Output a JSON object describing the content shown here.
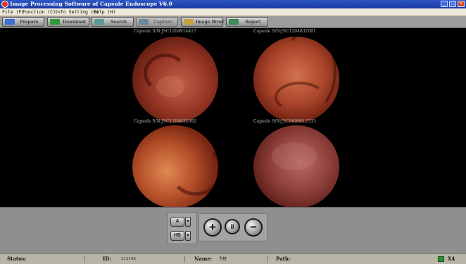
{
  "window": {
    "title": "Image Processing Software of Capsule Endoscope V6.0",
    "controls": [
      "_",
      "□",
      "×"
    ]
  },
  "menu": [
    {
      "label": "File (F)"
    },
    {
      "label": "Function (C)"
    },
    {
      "label": "Info Setting (I)"
    },
    {
      "label": "Help (H)"
    }
  ],
  "toolbar": [
    {
      "label": "Prepare",
      "icon": "prepare-icon",
      "color": "#3a6fd8"
    },
    {
      "label": "Download",
      "icon": "download-icon",
      "color": "#2f9a3a"
    },
    {
      "label": "Search",
      "icon": "search-icon",
      "color": "#5a9a9a"
    },
    {
      "label": "Capture",
      "icon": "capture-icon",
      "color": "#4f7fa0",
      "disabled": true
    },
    {
      "label": "Image Brow",
      "icon": "image-browse-icon",
      "color": "#c8a23a"
    },
    {
      "label": "Report",
      "icon": "report-icon",
      "color": "#3a8a5a"
    }
  ],
  "images": [
    {
      "caption": "Capsule S/N:JSC1204914417"
    },
    {
      "caption": "Capsule S/N:JSC1204832001"
    },
    {
      "caption": "Capsule S/N:JSC1204832002"
    },
    {
      "caption": "Capsule S/N:JSC0609012333"
    }
  ],
  "controls": {
    "mode_a": "A",
    "mode_b": "HB",
    "zoom_in": "+",
    "pause": "II",
    "zoom_out": "−"
  },
  "status": {
    "status_label": "Status:",
    "id_label": "ID:",
    "id_value": "212145",
    "name_label": "Name:",
    "name_value": "为娃",
    "path_label": "Path:",
    "zoom": "X4"
  }
}
